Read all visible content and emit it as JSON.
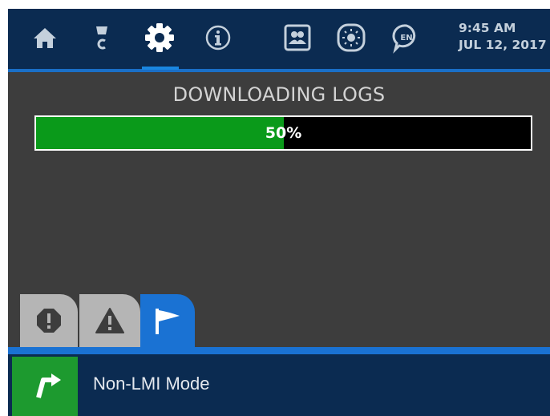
{
  "topbar": {
    "icons": [
      "home-icon",
      "connector-icon",
      "gear-icon",
      "info-icon",
      "contacts-icon",
      "brightness-icon",
      "language-icon"
    ],
    "language_code": "EN",
    "time": "9:45 AM",
    "date": "JUL 12, 2017"
  },
  "download": {
    "title": "DOWNLOADING LOGS",
    "progress_label": "50%",
    "progress_fraction": 0.5
  },
  "tabs": [
    "error-tab",
    "warning-tab",
    "flag-tab"
  ],
  "bottom": {
    "mode_label": "Non-LMI Mode"
  },
  "colors": {
    "bar_background": "#0b2b51",
    "accent_blue": "#1a72d3",
    "progress_green": "#0a9a1a",
    "mode_button_green": "#1d9a2f",
    "screen_background": "#3d3d3d"
  }
}
